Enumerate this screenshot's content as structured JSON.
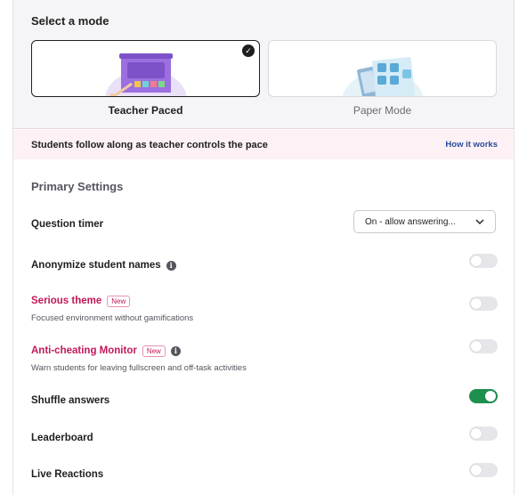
{
  "mode_section": {
    "title": "Select a mode",
    "modes": [
      {
        "label": "Teacher Paced",
        "selected": true
      },
      {
        "label": "Paper Mode",
        "selected": false
      }
    ]
  },
  "info_bar": {
    "text": "Students follow along as teacher controls the pace",
    "link": "How it works"
  },
  "settings": {
    "title": "Primary Settings",
    "question_timer": {
      "label": "Question timer",
      "value": "On - allow answering..."
    },
    "anonymize": {
      "label": "Anonymize student names",
      "enabled": false
    },
    "serious_theme": {
      "label": "Serious theme",
      "badge": "New",
      "description": "Focused environment without gamifications",
      "enabled": false
    },
    "anti_cheating": {
      "label": "Anti-cheating Monitor",
      "badge": "New",
      "description": "Warn students for leaving fullscreen and off-task activities",
      "enabled": false
    },
    "shuffle_answers": {
      "label": "Shuffle answers",
      "enabled": true
    },
    "leaderboard": {
      "label": "Leaderboard",
      "enabled": false
    },
    "live_reactions": {
      "label": "Live Reactions",
      "enabled": false
    }
  },
  "colors": {
    "accent_pink": "#c2185b",
    "toggle_on": "#1d8f4e",
    "link_blue": "#2a4b9b",
    "illustration_purple": "#9b6fe0"
  }
}
